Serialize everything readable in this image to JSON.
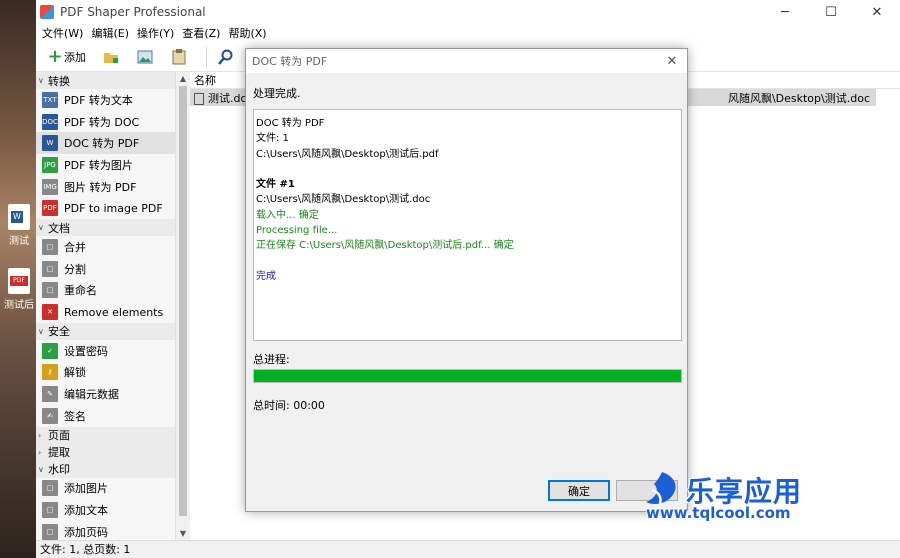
{
  "desktop": {
    "icons": [
      {
        "label": "测试",
        "type": "word"
      },
      {
        "label": "测试后",
        "type": "pdf"
      }
    ]
  },
  "window": {
    "title": "PDF Shaper Professional",
    "controls": {
      "minimize": "─",
      "maximize": "☐",
      "close": "✕"
    }
  },
  "menu": [
    "文件(W)",
    "编辑(E)",
    "操作(Y)",
    "查看(Z)",
    "帮助(X)"
  ],
  "toolbar": {
    "add_label": "添加"
  },
  "sidebar": {
    "groups": [
      {
        "title": "转换",
        "expanded": true,
        "items": [
          {
            "label": "PDF 转为文本",
            "icon": "TXT",
            "color": "#4a6fa5"
          },
          {
            "label": "PDF 转为 DOC",
            "icon": "DOC",
            "color": "#2b5797"
          },
          {
            "label": "DOC 转为 PDF",
            "icon": "W",
            "color": "#2b5797"
          },
          {
            "label": "PDF 转为图片",
            "icon": "JPG",
            "color": "#2e9e44"
          },
          {
            "label": "图片 转为 PDF",
            "icon": "IMG",
            "color": "#888888"
          },
          {
            "label": "PDF to image PDF",
            "icon": "PDF",
            "color": "#c9302c"
          }
        ]
      },
      {
        "title": "文档",
        "expanded": true,
        "items": [
          {
            "label": "合并",
            "icon": "□",
            "color": "#888888"
          },
          {
            "label": "分割",
            "icon": "□",
            "color": "#888888"
          },
          {
            "label": "重命名",
            "icon": "□",
            "color": "#888888"
          },
          {
            "label": "Remove elements",
            "icon": "✕",
            "color": "#c9302c"
          }
        ]
      },
      {
        "title": "安全",
        "expanded": true,
        "items": [
          {
            "label": "设置密码",
            "icon": "✓",
            "color": "#2e9e44"
          },
          {
            "label": "解锁",
            "icon": "⚷",
            "color": "#d4a017"
          },
          {
            "label": "编辑元数据",
            "icon": "✎",
            "color": "#888888"
          },
          {
            "label": "签名",
            "icon": "✍",
            "color": "#888888"
          }
        ]
      },
      {
        "title": "页面",
        "expanded": false,
        "items": []
      },
      {
        "title": "提取",
        "expanded": false,
        "items": []
      },
      {
        "title": "水印",
        "expanded": true,
        "items": [
          {
            "label": "添加图片",
            "icon": "□",
            "color": "#888888"
          },
          {
            "label": "添加文本",
            "icon": "□",
            "color": "#888888"
          },
          {
            "label": "添加页码",
            "icon": "□",
            "color": "#888888"
          }
        ]
      }
    ]
  },
  "list": {
    "column_name": "名称",
    "row": {
      "name": "测试.doc",
      "path": "风随风飘\\Desktop\\测试.doc"
    }
  },
  "status_bar": "文件: 1, 总页数: 1",
  "dialog": {
    "title": "DOC 转为 PDF",
    "status": "处理完成.",
    "log": [
      {
        "text": "DOC 转为 PDF",
        "style": "normal"
      },
      {
        "text": "文件: 1",
        "style": "normal"
      },
      {
        "text": "C:\\Users\\风随风飘\\Desktop\\测试后.pdf",
        "style": "normal"
      },
      {
        "text": "",
        "style": "blank"
      },
      {
        "text": "文件 #1",
        "style": "bold"
      },
      {
        "text": "C:\\Users\\风随风飘\\Desktop\\测试.doc",
        "style": "normal"
      },
      {
        "text": "载入中... 确定",
        "style": "green"
      },
      {
        "text": "Processing file...",
        "style": "green"
      },
      {
        "text": "正在保存 C:\\Users\\风随风飘\\Desktop\\测试后.pdf... 确定",
        "style": "green"
      },
      {
        "text": "",
        "style": "blank"
      },
      {
        "text": "完成",
        "style": "blue"
      }
    ],
    "progress_label": "总进程:",
    "progress": 1.0,
    "total_time": "总时间: 00:00",
    "ok_label": "确定"
  },
  "watermark": {
    "brand": "乐享应用",
    "url": "www.tqlcool.com"
  },
  "colors": {
    "progress": "#06b025",
    "log_green": "#1a8a1a",
    "log_blue": "#2020cc",
    "brand_blue": "#1a5fd6"
  }
}
